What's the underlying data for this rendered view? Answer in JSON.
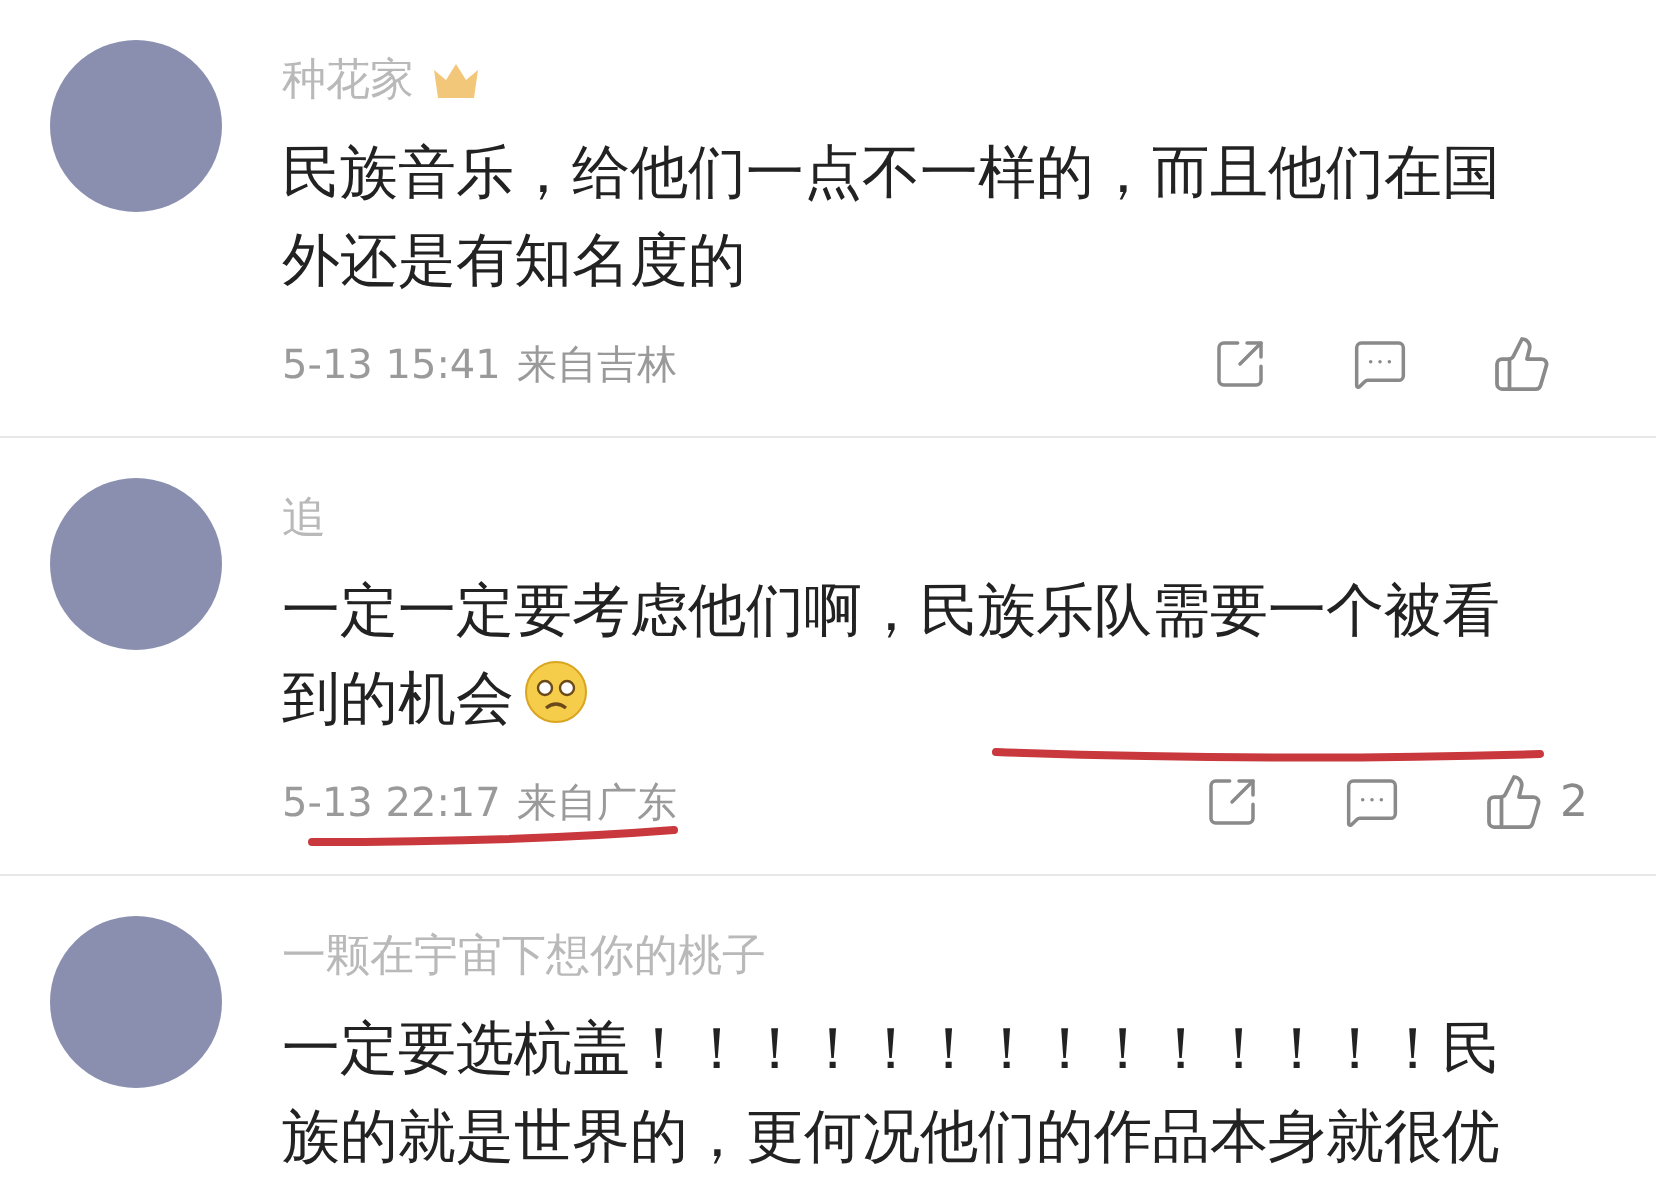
{
  "comments": [
    {
      "name": "种花家",
      "badge": true,
      "text": "民族音乐，给他们一点不一样的，而且他们在国外还是有知名度的",
      "trailing_emoji": false,
      "time": "5-13 15:41",
      "location": "来自吉林"
    },
    {
      "name": "追",
      "badge": false,
      "text": "一定一定要考虑他们啊，民族乐队需要一个被看到的机会",
      "trailing_emoji": true,
      "time": "5-13 22:17",
      "location": "来自广东",
      "likes": "2"
    },
    {
      "name": "一颗在宇宙下想你的桃子",
      "badge": false,
      "text": "一定要选杭盖！！！！！！！！！！！！！！民族的就是世界的，更何况他们的作品本身就很优",
      "trailing_emoji": false
    }
  ]
}
